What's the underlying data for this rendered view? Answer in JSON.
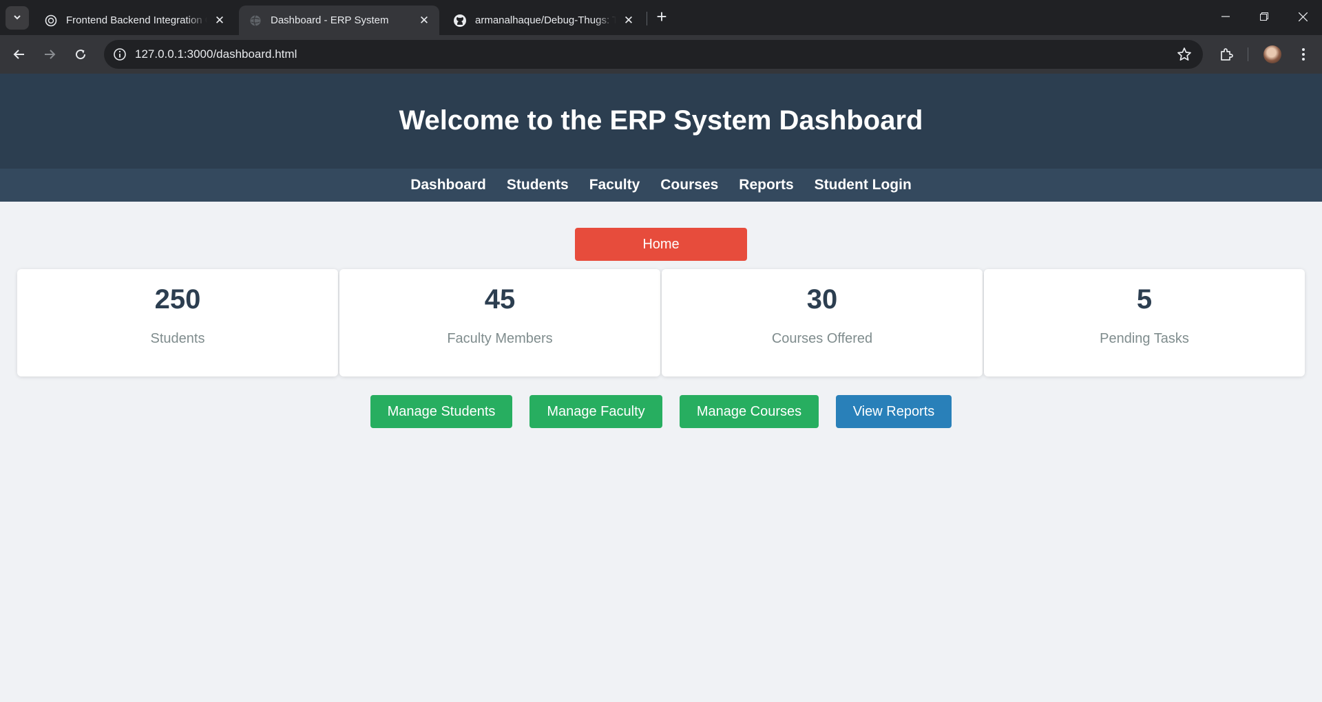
{
  "browser": {
    "tabs": [
      {
        "title": "Frontend Backend Integration G",
        "icon": "openai-icon",
        "active": false
      },
      {
        "title": "Dashboard - ERP System",
        "icon": "globe-icon",
        "active": true
      },
      {
        "title": "armanalhaque/Debug-Thugs: Th",
        "icon": "github-icon",
        "active": false
      }
    ],
    "url": "127.0.0.1:3000/dashboard.html"
  },
  "header": {
    "title": "Welcome to the ERP System Dashboard"
  },
  "nav": {
    "items": [
      "Dashboard",
      "Students",
      "Faculty",
      "Courses",
      "Reports",
      "Student Login"
    ]
  },
  "home_button": "Home",
  "stats": [
    {
      "value": "250",
      "label": "Students"
    },
    {
      "value": "45",
      "label": "Faculty Members"
    },
    {
      "value": "30",
      "label": "Courses Offered"
    },
    {
      "value": "5",
      "label": "Pending Tasks"
    }
  ],
  "actions": [
    {
      "label": "Manage Students",
      "color": "#27ae60"
    },
    {
      "label": "Manage Faculty",
      "color": "#27ae60"
    },
    {
      "label": "Manage Courses",
      "color": "#27ae60"
    },
    {
      "label": "View Reports",
      "color": "#2980b9"
    }
  ],
  "colors": {
    "header_bg": "#2c3e50",
    "nav_bg": "#34495e",
    "home_button": "#e74c3c",
    "page_bg": "#f0f2f5"
  }
}
